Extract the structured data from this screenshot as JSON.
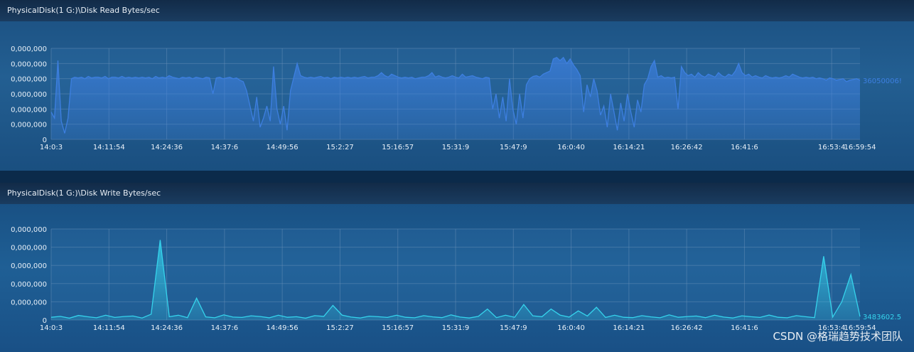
{
  "chart_data": [
    {
      "type": "area",
      "title": "PhysicalDisk(1 G:)\\Disk Read Bytes/sec",
      "x_tick_labels": [
        "14:0:3",
        "14:11:54",
        "14:24:36",
        "14:37:6",
        "14:49:56",
        "15:2:27",
        "15:16:57",
        "15:31:9",
        "15:47:9",
        "16:0:40",
        "16:14:21",
        "16:26:42",
        "16:41:6",
        "16:53:4",
        "16:59:54"
      ],
      "y_tick_labels": [
        "0",
        "0,000,000",
        "0,000,000",
        "0,000,000",
        "0,000,000",
        "0,000,000",
        "0,000,000"
      ],
      "ylim": [
        0,
        60000000
      ],
      "end_value_label": "36050006!",
      "grid": true,
      "color": "#3d7fe0",
      "values": [
        18000000,
        14000000,
        52000000,
        12000000,
        4000000,
        14000000,
        40000000,
        41000000,
        40500000,
        41000000,
        40000000,
        41500000,
        40500000,
        41000000,
        41000000,
        40500000,
        41500000,
        40000000,
        41000000,
        41000000,
        40500000,
        41500000,
        40500000,
        41000000,
        40500000,
        41000000,
        40500000,
        41000000,
        40500000,
        41000000,
        40000000,
        41500000,
        40500000,
        41000000,
        40500000,
        42000000,
        41000000,
        40500000,
        40000000,
        41000000,
        40500000,
        41000000,
        40000000,
        41000000,
        40500000,
        40000000,
        41000000,
        40500000,
        30000000,
        40500000,
        41000000,
        40000000,
        40500000,
        41000000,
        40000000,
        40500000,
        39000000,
        38000000,
        32000000,
        22000000,
        12000000,
        28000000,
        8000000,
        14000000,
        22000000,
        12000000,
        48000000,
        20000000,
        10000000,
        22000000,
        6000000,
        32000000,
        41000000,
        50000000,
        42000000,
        41000000,
        40500000,
        41000000,
        40500000,
        41000000,
        41500000,
        40500000,
        41000000,
        40000000,
        41000000,
        40500000,
        41000000,
        40500000,
        41000000,
        40500000,
        41000000,
        40500000,
        41000000,
        41500000,
        40500000,
        41000000,
        41000000,
        42000000,
        44000000,
        42000000,
        41000000,
        43000000,
        42000000,
        41000000,
        40500000,
        41000000,
        40500000,
        41000000,
        40000000,
        40500000,
        41000000,
        41000000,
        42000000,
        44000000,
        41000000,
        42000000,
        41000000,
        40500000,
        41000000,
        42000000,
        41000000,
        40500000,
        43000000,
        41000000,
        41500000,
        42000000,
        41000000,
        40500000,
        40000000,
        41000000,
        40500000,
        20000000,
        30000000,
        14000000,
        28000000,
        12000000,
        40000000,
        20000000,
        10000000,
        30000000,
        14000000,
        36000000,
        40000000,
        41500000,
        42000000,
        41000000,
        43000000,
        44000000,
        45000000,
        53000000,
        54000000,
        52000000,
        54000000,
        50000000,
        53000000,
        49000000,
        46000000,
        42000000,
        18000000,
        36000000,
        28000000,
        40000000,
        32000000,
        16000000,
        22000000,
        8000000,
        30000000,
        18000000,
        6000000,
        24000000,
        12000000,
        30000000,
        18000000,
        8000000,
        26000000,
        18000000,
        36000000,
        40000000,
        48000000,
        52000000,
        41000000,
        42000000,
        40500000,
        41000000,
        40500000,
        41000000,
        20000000,
        48000000,
        44000000,
        42000000,
        43000000,
        41000000,
        44000000,
        42000000,
        41000000,
        43000000,
        42000000,
        41000000,
        44000000,
        42000000,
        41000000,
        43000000,
        42000000,
        45000000,
        50000000,
        44000000,
        42000000,
        43000000,
        41000000,
        42000000,
        41000000,
        40500000,
        42000000,
        41000000,
        40500000,
        41000000,
        40500000,
        41000000,
        42000000,
        41000000,
        43000000,
        42000000,
        41000000,
        40500000,
        41000000,
        40500000,
        41000000,
        40000000,
        40500000,
        40000000,
        39000000,
        40500000,
        40000000,
        39000000,
        39500000,
        40000000,
        38000000,
        39000000,
        39500000,
        40000000,
        39000000
      ]
    },
    {
      "type": "area",
      "title": "PhysicalDisk(1 G:)\\Disk Write Bytes/sec",
      "x_tick_labels": [
        "14:0:3",
        "14:11:54",
        "14:24:36",
        "14:37:6",
        "14:49:56",
        "15:2:27",
        "15:16:57",
        "15:31:9",
        "15:47:9",
        "16:0:40",
        "16:14:21",
        "16:26:42",
        "16:41:6",
        "16:53:4",
        "16:59:54"
      ],
      "y_tick_labels": [
        "0",
        "0,000,000",
        "0,000,000",
        "0,000,000",
        "0,000,000",
        "0,000,000"
      ],
      "ylim": [
        0,
        50000000
      ],
      "end_value_label": "3483602.5",
      "grid": true,
      "color": "#35d3ec",
      "values": [
        1500000,
        2000000,
        1000000,
        2500000,
        1800000,
        1200000,
        2600000,
        1400000,
        1900000,
        2200000,
        1100000,
        3200000,
        1500000,
        1800000,
        2600000,
        1300000,
        2000000,
        1700000,
        1200000,
        2800000,
        1600000,
        1400000,
        2300000,
        1900000,
        1200000,
        2600000,
        1500000,
        1800000,
        1000000,
        2400000,
        2000000,
        1300000,
        2700000,
        1600000,
        1100000,
        2100000,
        1800000,
        1400000,
        2600000,
        1500000,
        1200000,
        2400000,
        1700000,
        1300000,
        2800000,
        1600000,
        1100000,
        2000000,
        1900000,
        1300000,
        2600000,
        1500000,
        1200000,
        2300000,
        1800000,
        1400000,
        2700000,
        1600000,
        1100000,
        2200000,
        1800000,
        1400000,
        2600000,
        1500000,
        1300000,
        2400000,
        1700000,
        1200000,
        2800000,
        1500000,
        1900000,
        2200000,
        1300000,
        2600000,
        1600000,
        1100000,
        2300000,
        1800000,
        1400000,
        2700000,
        1500000,
        1200000,
        2400000,
        1800000,
        1300000,
        2600000,
        1600000,
        1100000,
        2200000,
        1900000
      ]
    }
  ],
  "watermark": "CSDN @格瑞趋势技术团队"
}
